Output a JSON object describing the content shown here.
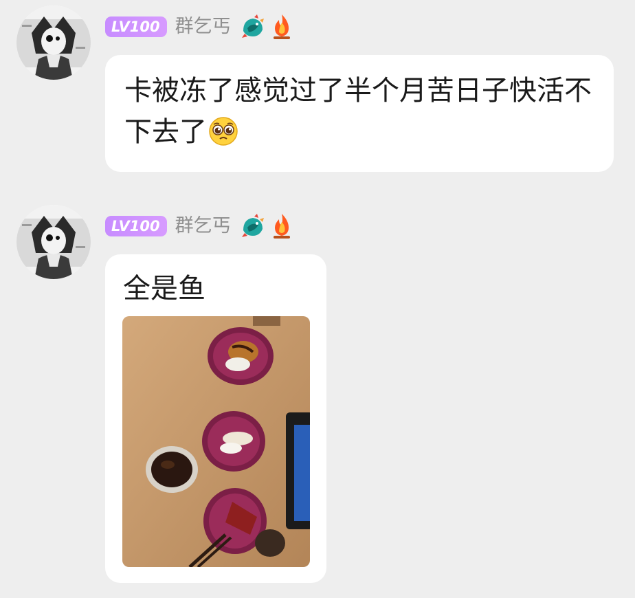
{
  "messages": [
    {
      "level_badge": "LV100",
      "nickname": "群乞丐",
      "text": "卡被冻了感觉过了半个月苦日子快活不下去了",
      "emoji": "pleading-face-icon"
    },
    {
      "level_badge": "LV100",
      "nickname": "群乞丐",
      "text": "全是鱼",
      "image": "sushi-plates-photo"
    }
  ],
  "icons": {
    "medal_1": "dragon-medal-icon",
    "medal_2": "fire-medal-icon"
  },
  "colors": {
    "background": "#eeeeee",
    "bubble": "#ffffff",
    "level_badge": "#cf93ff",
    "nickname": "#8f8f8f",
    "text": "#1a1a1a"
  }
}
